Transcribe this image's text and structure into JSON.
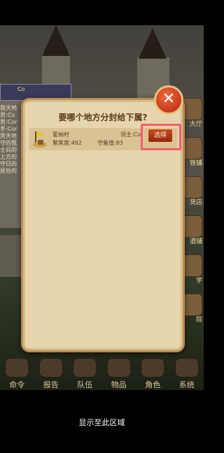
{
  "modal": {
    "title": "要哪个地方分封给下属?",
    "close_label": "✕",
    "rows": [
      {
        "name": "霍纳村",
        "lord": "领主:Co",
        "prosperity": "繁荣度:492",
        "defense": "守备值:83",
        "select_label": "选择"
      }
    ]
  },
  "toolbar": {
    "items": [
      {
        "label": "命令"
      },
      {
        "label": "报告"
      },
      {
        "label": "队伍"
      },
      {
        "label": "物品"
      },
      {
        "label": "角色"
      },
      {
        "label": "系统"
      }
    ]
  },
  "side_buttons": [
    "大厅",
    "铁铺",
    "货店",
    "酒铺",
    "学",
    "院"
  ],
  "player": {
    "name": "Co",
    "lines": [
      "我天地",
      "男:Co",
      "男:Cor",
      "手:Cor",
      "男天地",
      "守的我",
      "士兵的",
      "上方的",
      "守日的",
      "居处的"
    ]
  },
  "bottom_hint": "显示至此区域"
}
